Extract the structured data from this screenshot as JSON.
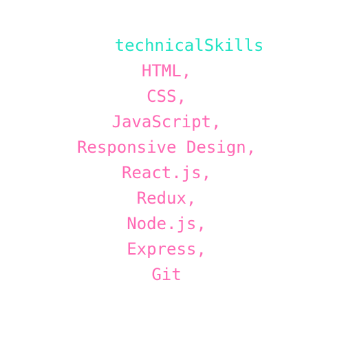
{
  "heading": "technicalSkills",
  "skills": [
    "HTML,",
    "CSS,",
    "JavaScript,",
    "Responsive Design,",
    "React.js,",
    "Redux,",
    "Node.js,",
    "Express,",
    "Git"
  ],
  "colors": {
    "heading": "#22e3c4",
    "skill": "#ff69b4",
    "background": "#ffffff"
  }
}
